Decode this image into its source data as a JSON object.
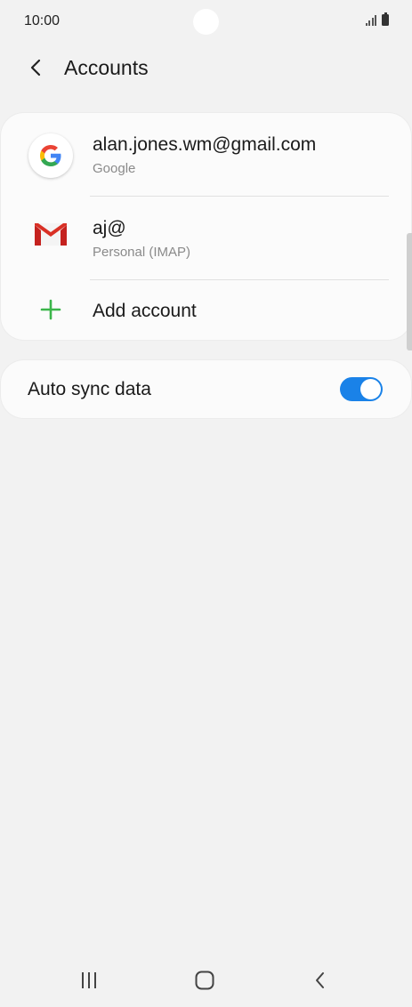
{
  "status_bar": {
    "time": "10:00"
  },
  "header": {
    "title": "Accounts"
  },
  "accounts": [
    {
      "title": "alan.jones.wm@gmail.com",
      "subtitle": "Google",
      "icon": "google-icon"
    },
    {
      "title": "aj@",
      "subtitle": "Personal (IMAP)",
      "icon": "gmail-icon"
    }
  ],
  "add_account": {
    "label": "Add account",
    "icon": "plus-icon"
  },
  "auto_sync": {
    "label": "Auto sync data",
    "enabled": true
  },
  "colors": {
    "accent_blue": "#1a82e8",
    "plus_green": "#3bb54a",
    "gmail_red": "#d93025",
    "background": "#f2f2f2"
  }
}
